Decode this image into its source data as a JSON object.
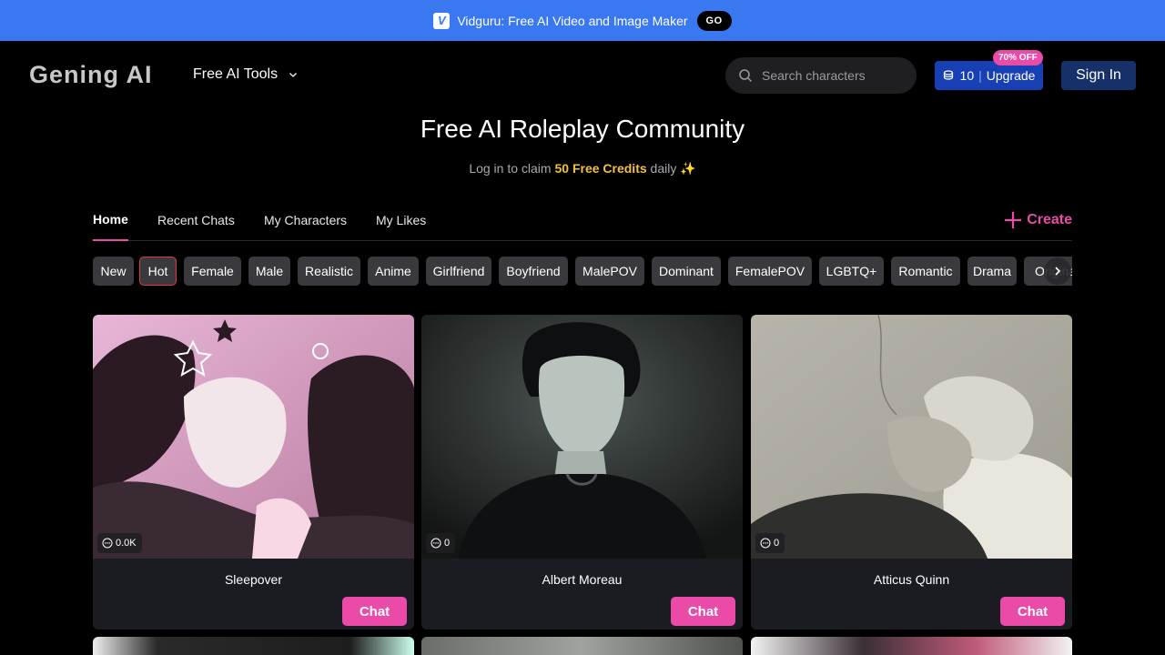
{
  "promo": {
    "logo_glyph": "V",
    "text": "Vidguru: Free AI Video and Image Maker",
    "go_label": "GO"
  },
  "header": {
    "brand": "Gening AI",
    "tools_label": "Free AI Tools",
    "search_placeholder": "Search characters",
    "credits": "10",
    "upgrade_label": "Upgrade",
    "discount_badge": "70% OFF",
    "signin_label": "Sign In"
  },
  "hero": {
    "title": "Free AI Roleplay Community",
    "sub_prefix": "Log in to claim",
    "sub_highlight": "50 Free Credits",
    "sub_suffix": "daily ✨"
  },
  "tabs": {
    "items": [
      "Home",
      "Recent Chats",
      "My Characters",
      "My Likes"
    ],
    "create_label": "Create"
  },
  "filters": [
    "New",
    "Hot",
    "Female",
    "Male",
    "Realistic",
    "Anime",
    "Girlfriend",
    "Boyfriend",
    "MalePOV",
    "Dominant",
    "FemalePOV",
    "LGBTQ+",
    "Romantic",
    "Drama",
    "Original"
  ],
  "selected_filter": "Hot",
  "cards": [
    {
      "name": "Sleepover",
      "count": "0.0K",
      "chat_label": "Chat"
    },
    {
      "name": "Albert Moreau",
      "count": "0",
      "chat_label": "Chat"
    },
    {
      "name": "Atticus Quinn",
      "count": "0",
      "chat_label": "Chat"
    }
  ],
  "colors": {
    "promo_bg": "#3a78f2",
    "accent_pink": "#ea4aa8",
    "upgrade_bg": "#1740b5",
    "signin_bg": "#16306a",
    "gold": "#f3c043",
    "card_bg": "#1b1c22"
  }
}
